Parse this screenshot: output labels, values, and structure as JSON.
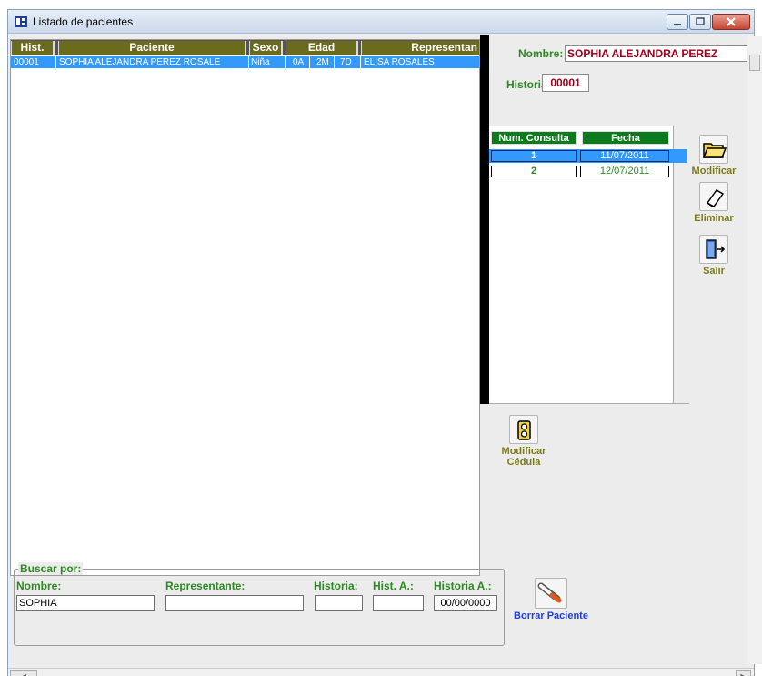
{
  "window": {
    "title": "Listado de pacientes"
  },
  "grid": {
    "columns": [
      "Hist.",
      "Paciente",
      "Sexo",
      "Edad",
      "Representan"
    ],
    "rows": [
      {
        "hist": "00001",
        "paciente": "SOPHIA  ALEJANDRA PEREZ ROSALE",
        "sexo": "Niña",
        "edad_a": "0A",
        "edad_m": "2M",
        "edad_d": "7D",
        "representante": "ELISA ROSALES"
      }
    ]
  },
  "detail": {
    "nombre_label": "Nombre:",
    "nombre_value": "SOPHIA  ALEJANDRA PEREZ",
    "historia_label": "Historia:",
    "historia_value": "00001"
  },
  "consultas": {
    "columns": [
      "Num. Consulta",
      "Fecha"
    ],
    "rows": [
      {
        "num": "1",
        "fecha": "11/07/2011"
      },
      {
        "num": "2",
        "fecha": "12/07/2011"
      }
    ]
  },
  "tools": {
    "modificar": "Modificar",
    "eliminar": "Eliminar",
    "salir": "Salir",
    "modificar_cedula_1": "Modificar",
    "modificar_cedula_2": "Cédula",
    "borrar_paciente": "Borrar Paciente"
  },
  "search": {
    "legend": "Buscar por:",
    "nombre_label": "Nombre:",
    "nombre_value": "SOPHIA",
    "representante_label": "Representante:",
    "representante_value": "",
    "historia_label": "Historia:",
    "historia_value": "",
    "hist_a_label": "Hist. A.:",
    "hist_a_value": "",
    "historia_a_label": "Historia A.:",
    "historia_a_value": "00/00/0000"
  },
  "colors": {
    "selection": "#3399ff",
    "header_olive": "#6b6b1e",
    "label_green": "#2b8a1f",
    "value_red": "#a0001c"
  }
}
